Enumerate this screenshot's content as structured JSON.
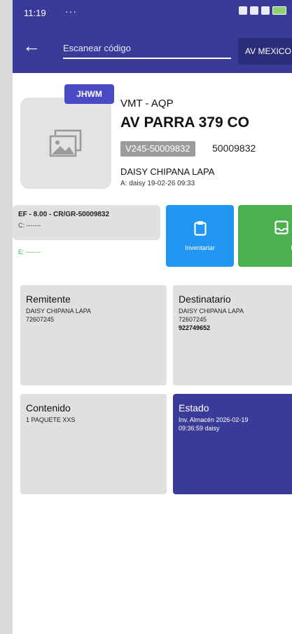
{
  "status_bar": {
    "time": "11:19",
    "dots": "···"
  },
  "app_bar": {
    "search_placeholder": "Escanear código",
    "branch_button": "AV MEXICO"
  },
  "shipment": {
    "badge": "JHWM",
    "route": "VMT - AQP",
    "address": "AV PARRA 379 CO",
    "guide_code": "V245-50009832",
    "guide_number": "50009832",
    "client": "DAISY CHIPANA LAPA",
    "audit": "A: daisy 19-02-26 09:33"
  },
  "fee": {
    "line1": "EF - 8.00 - CR/GR-50009832",
    "line2": "C: -------",
    "line3": "E: -------"
  },
  "actions": {
    "inventory_label": "Inventariar",
    "deliver_label": "Entrega"
  },
  "cards": {
    "sender": {
      "title": "Remitente",
      "name": "DAISY CHIPANA LAPA",
      "doc": "72607245"
    },
    "recipient": {
      "title": "Destinatario",
      "name": "DAISY CHIPANA LAPA",
      "doc": "72607245",
      "phone": "922749652"
    },
    "contents": {
      "title": "Contenido",
      "text": "1 PAQUETE XXS"
    },
    "status": {
      "title": "Estado",
      "line1": "Inv. Almacén 2026-02-19",
      "line2": "09:36:59 daisy"
    }
  },
  "colors": {
    "primary": "#3a3b98",
    "badge": "#4a4bc4",
    "inventory": "#2196f3",
    "deliver": "#4caf50"
  }
}
